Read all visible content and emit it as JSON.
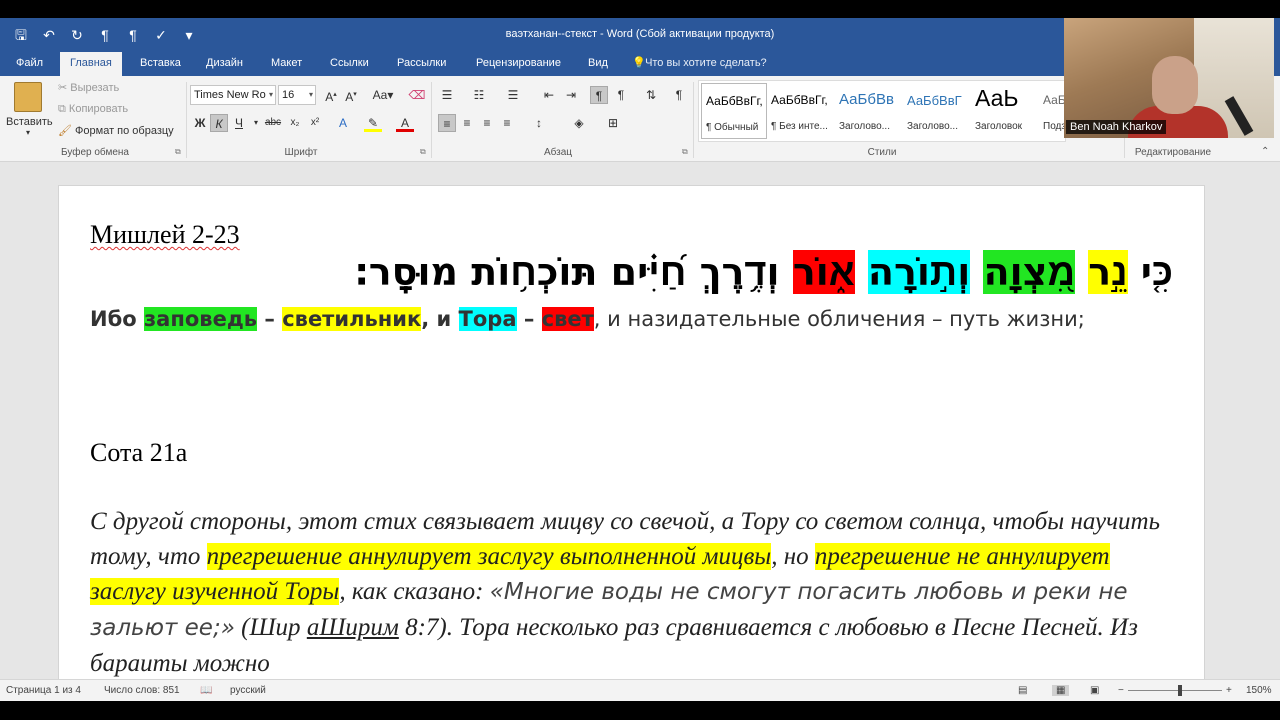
{
  "window": {
    "title": "ваэтханан--стекст - Word (Сбой активации продукта)"
  },
  "tabs": [
    {
      "label": "Файл"
    },
    {
      "label": "Главная"
    },
    {
      "label": "Вставка"
    },
    {
      "label": "Дизайн"
    },
    {
      "label": "Макет"
    },
    {
      "label": "Ссылки"
    },
    {
      "label": "Рассылки"
    },
    {
      "label": "Рецензирование"
    },
    {
      "label": "Вид"
    }
  ],
  "tell_me": "Что вы хотите сделать?",
  "clipboard": {
    "paste": "Вставить",
    "cut": "Вырезать",
    "copy": "Копировать",
    "format_painter": "Формат по образцу",
    "group": "Буфер обмена"
  },
  "font": {
    "name": "Times New Ro",
    "size": "16",
    "group": "Шрифт"
  },
  "paragraph": {
    "group": "Абзац"
  },
  "styles": {
    "group": "Стили",
    "items": [
      {
        "sample": "АаБбВвГг,",
        "name": "¶ Обычный"
      },
      {
        "sample": "АаБбВвГг,",
        "name": "¶ Без инте..."
      },
      {
        "sample": "АаБбВв",
        "name": "Заголово..."
      },
      {
        "sample": "АаБбВвГ",
        "name": "Заголово..."
      },
      {
        "sample": "АаЬ",
        "name": "Заголовок"
      },
      {
        "sample": "АаБ",
        "name": "Подз"
      }
    ]
  },
  "editing": {
    "group": "Редактирование"
  },
  "webcam": {
    "name": "Ben Noah Kharkov"
  },
  "document": {
    "heading1": "Мишлей 2-23",
    "hebrew": {
      "w1": "כִּ֤י",
      "w2": "נֵ֣ר",
      "w3": "מִ֭צְוָה",
      "w4": "וְת֣וֹרָה",
      "w5": "א֑וֹר",
      "rest": "וְדֶ֥רֶךְ חַ֝יִּ֗ים תּוֹכְח֥וֹת מוּסָֽר׃"
    },
    "translation": {
      "t1": "Ибо ",
      "commandment": "заповедь",
      "t2": " – ",
      "lamp": "светильник",
      "t3": ", и ",
      "torah": "Тора",
      "t4": " – ",
      "light": "свет",
      "t5": ", и назидательные обличения – путь жизни;"
    },
    "heading2": "Сота 21а",
    "sota": {
      "p1": "С другой стороны, этот стих связывает мицву со свечой, а Тору со светом солнца, чтобы научить тому, что ",
      "h1": "прегрешение аннулирует заслугу выполненной мицвы",
      "p2": ", но ",
      "h2": "прегрешение не аннулирует заслугу изученной Торы",
      "p3": ", как сказано: ",
      "quote": "«Многие воды не смогут погасить любовь и реки не зальют ее;»",
      "p4": " (Шир ",
      "ref": "аШирим",
      "p5": " 8:7). Тора несколько раз сравнивается с любовью в Песне Песней. Из бараиты можно"
    }
  },
  "status": {
    "page": "Страница 1 из 4",
    "words": "Число слов: 851",
    "lang": "русский",
    "zoom": "150%"
  },
  "colors": {
    "accent": "#2b579a",
    "highlight_yellow": "#ffff00",
    "highlight_green": "#22e622",
    "highlight_cyan": "#00ffff",
    "highlight_red": "#ff0000"
  }
}
